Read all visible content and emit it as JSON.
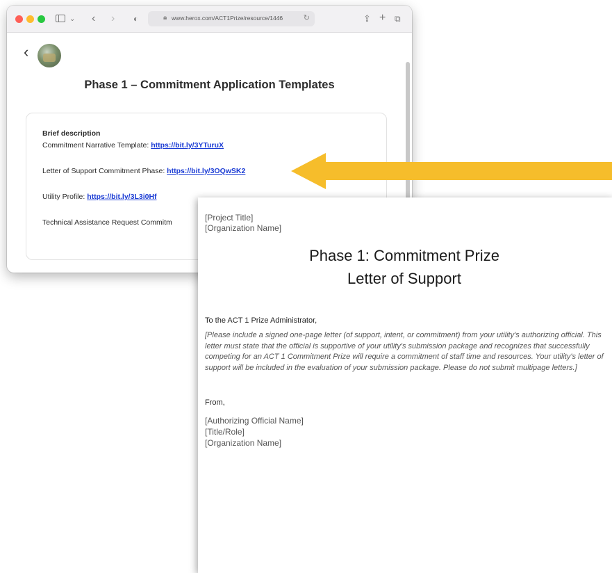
{
  "browser": {
    "url": "www.herox.com/ACT1Prize/resource/1446"
  },
  "page": {
    "title": "Phase 1 – Commitment Application Templates",
    "brief_label": "Brief description",
    "items": [
      {
        "label": "Commitment Narrative Template: ",
        "link": "https://bit.ly/3YTuruX"
      },
      {
        "label": "Letter of Support Commitment Phase: ",
        "link": "https://bit.ly/3OQwSK2"
      },
      {
        "label": "Utility Profile: ",
        "link": "https://bit.ly/3L3i0Hf"
      },
      {
        "label": "Technical Assistance Request Commitm",
        "link": ""
      }
    ]
  },
  "arrow": {
    "color": "#f6bd2b"
  },
  "letter": {
    "project_title": "[Project Title]",
    "org_name_top": "[Organization Name]",
    "heading_line1": "Phase 1: Commitment Prize",
    "heading_line2": "Letter of Support",
    "salutation": "To the ACT 1 Prize Administrator,",
    "body": "[Please include a signed one-page letter (of support, intent, or commitment) from your utility's authorizing official. This letter must state that the official is supportive of your utility's submission package and recognizes that successfully competing for an ACT 1 Commitment Prize will require a commitment of staff time and resources. Your utility's letter of support will be included in the evaluation of your submission package. Please do not submit multipage letters.]",
    "from": "From,",
    "official_name": "[Authorizing Official Name]",
    "title_role": "[Title/Role]",
    "org_name_bottom": "[Organization Name]"
  }
}
